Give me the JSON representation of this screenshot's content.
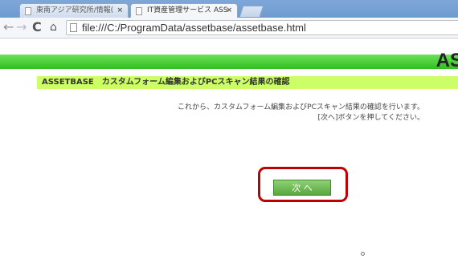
{
  "browser": {
    "tabs": [
      {
        "label": "東南アジア研究所/情報("
      },
      {
        "label": "IT資産管理サービス ASS"
      }
    ],
    "close_glyph": "×",
    "url": "file:///C:/ProgramData/assetbase/assetbase.html",
    "icons": {
      "back": "←",
      "forward": "→",
      "reload": "C",
      "home": "⌂"
    }
  },
  "page": {
    "logo_text": "AS",
    "title": "ASSETBASE　カスタムフォーム編集およびPCスキャン結果の確認",
    "description_line1": "これから、カスタムフォーム編集およびPCスキャン結果の確認を行います。",
    "description_line2": "[次へ]ボタンを押してください。",
    "next_button_label": "次 へ"
  },
  "colors": {
    "green_bar": "#2fbf1e",
    "title_bar": "#ccff66",
    "button": "#57a83e",
    "highlight": "#c00000"
  }
}
